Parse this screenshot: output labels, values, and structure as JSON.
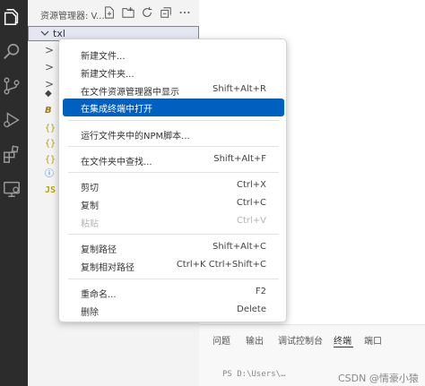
{
  "sidebar": {
    "title": "资源管理器: V...",
    "root_label": "txl",
    "tree_icons": [
      {
        "name": "chevron-right-icon",
        "glyph": ">",
        "cls": "ico-chev"
      },
      {
        "name": "chevron-right-icon",
        "glyph": ">",
        "cls": "ico-chev"
      },
      {
        "name": "chevron-right-icon",
        "glyph": ">",
        "cls": "ico-chev"
      },
      {
        "name": "config-file-icon",
        "glyph": "◆",
        "cls": "ico-dot"
      },
      {
        "name": "babel-file-icon",
        "glyph": "B",
        "cls": "ico-b"
      },
      {
        "name": "json-file-icon",
        "glyph": "{}",
        "cls": "ico-json"
      },
      {
        "name": "json-file-icon",
        "glyph": "{}",
        "cls": "ico-json"
      },
      {
        "name": "json-file-icon",
        "glyph": "{}",
        "cls": "ico-json"
      },
      {
        "name": "info-file-icon",
        "glyph": "ⓘ",
        "cls": "ico-info"
      },
      {
        "name": "js-file-icon",
        "glyph": "JS",
        "cls": "ico-js"
      }
    ]
  },
  "context_menu": {
    "items": [
      {
        "label": "新建文件...",
        "shortcut": "",
        "state": "normal"
      },
      {
        "label": "新建文件夹...",
        "shortcut": "",
        "state": "normal"
      },
      {
        "label": "在文件资源管理器中显示",
        "shortcut": "Shift+Alt+R",
        "state": "normal"
      },
      {
        "label": "在集成终端中打开",
        "shortcut": "",
        "state": "selected"
      },
      {
        "label": "运行文件夹中的NPM脚本...",
        "shortcut": "",
        "state": "normal"
      },
      {
        "label": "在文件夹中查找...",
        "shortcut": "Shift+Alt+F",
        "state": "normal"
      },
      {
        "label": "剪切",
        "shortcut": "Ctrl+X",
        "state": "normal"
      },
      {
        "label": "复制",
        "shortcut": "Ctrl+C",
        "state": "normal"
      },
      {
        "label": "粘贴",
        "shortcut": "Ctrl+V",
        "state": "disabled"
      },
      {
        "label": "复制路径",
        "shortcut": "Shift+Alt+C",
        "state": "normal"
      },
      {
        "label": "复制相对路径",
        "shortcut": "Ctrl+K Ctrl+Shift+C",
        "state": "normal"
      },
      {
        "label": "重命名...",
        "shortcut": "F2",
        "state": "normal"
      },
      {
        "label": "删除",
        "shortcut": "Delete",
        "state": "normal"
      }
    ]
  },
  "panel": {
    "tabs": [
      "问题",
      "输出",
      "调试控制台",
      "终端",
      "端口"
    ],
    "active_tab": "终端",
    "partial_line": "PS D:\\Users\\…"
  },
  "watermark": "CSDN @情豪小猿",
  "colors": {
    "activity_bar": "#2c2c2c",
    "sidebar": "#f3f3f3",
    "selection": "#0060c0",
    "focus_border": "#4d90d6"
  }
}
